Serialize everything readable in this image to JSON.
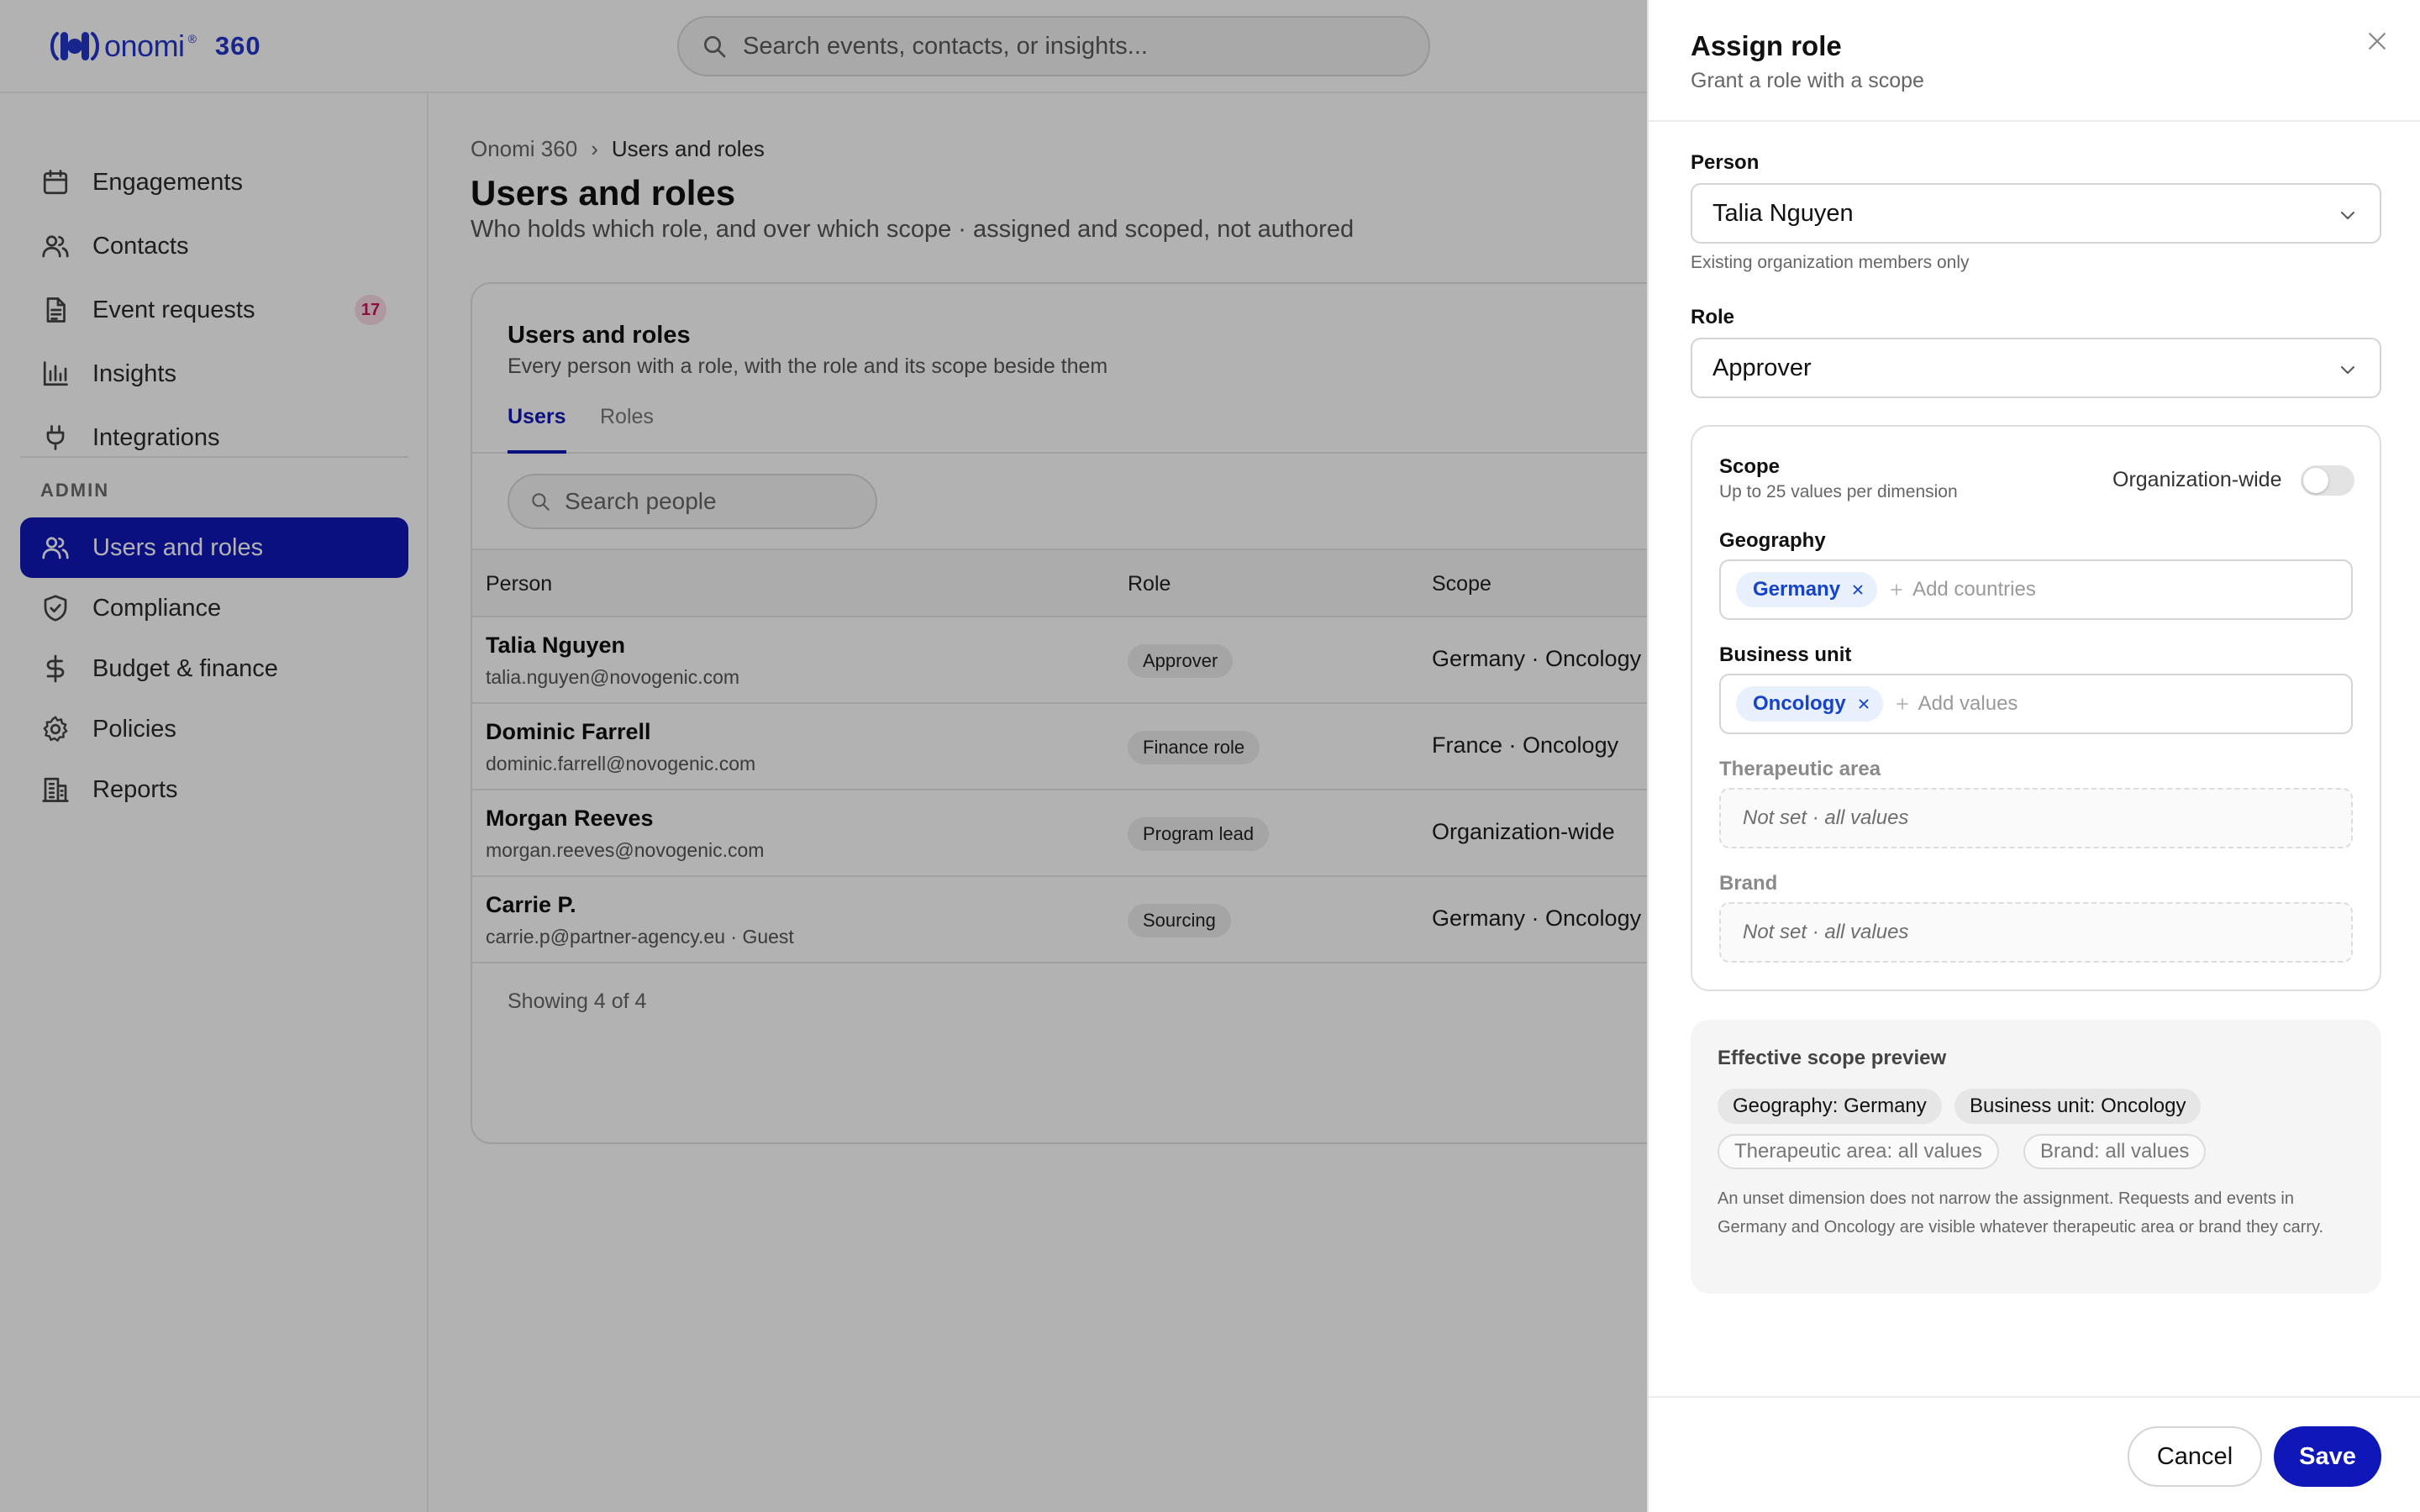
{
  "brand": {
    "logo_text": "onomi",
    "logo_reg": "®",
    "product": "360",
    "accent": "#1017b8"
  },
  "header": {
    "search_placeholder": "Search events, contacts, or insights..."
  },
  "sidebar": {
    "items": [
      {
        "label": "Engagements",
        "icon": "calendar-icon"
      },
      {
        "label": "Contacts",
        "icon": "users-icon"
      },
      {
        "label": "Event requests",
        "icon": "document-icon",
        "badge": "17"
      },
      {
        "label": "Insights",
        "icon": "bar-chart-icon"
      },
      {
        "label": "Integrations",
        "icon": "plug-icon"
      }
    ],
    "admin_section": "ADMIN",
    "admin_items": [
      {
        "label": "Users and roles",
        "icon": "users-icon",
        "active": true
      },
      {
        "label": "Compliance",
        "icon": "shield-icon"
      },
      {
        "label": "Budget & finance",
        "icon": "dollar-icon"
      },
      {
        "label": "Policies",
        "icon": "gear-icon"
      },
      {
        "label": "Reports",
        "icon": "building-icon"
      }
    ]
  },
  "main": {
    "breadcrumb": {
      "root": "Onomi 360",
      "sep": "›",
      "current": "Users and roles"
    },
    "title": "Users and roles",
    "subtitle": "Who holds which role, and over which scope · assigned and scoped, not authored",
    "card": {
      "title": "Users and roles",
      "subtitle": "Every person with a role, with the role and its scope beside them",
      "tabs": [
        "Users",
        "Roles"
      ],
      "search_placeholder": "Search people",
      "columns": [
        "Person",
        "Role",
        "Scope"
      ],
      "rows": [
        {
          "name": "Talia Nguyen",
          "email": "talia.nguyen@novogenic.com",
          "role": "Approver",
          "scope": "Germany · Oncology"
        },
        {
          "name": "Dominic Farrell",
          "email": "dominic.farrell@novogenic.com",
          "role": "Finance role",
          "scope": "France · Oncology"
        },
        {
          "name": "Morgan Reeves",
          "email": "morgan.reeves@novogenic.com",
          "role": "Program lead",
          "scope": "Organization-wide"
        },
        {
          "name": "Carrie P.",
          "email": "carrie.p@partner-agency.eu · Guest",
          "role": "Sourcing",
          "scope": "Germany · Oncology"
        }
      ],
      "footer": "Showing 4 of 4"
    }
  },
  "drawer": {
    "title": "Assign role",
    "subtitle": "Grant a role with a scope",
    "person_label": "Person",
    "person_value": "Talia Nguyen",
    "person_helper": "Existing organization members only",
    "role_label": "Role",
    "role_value": "Approver",
    "scope": {
      "title": "Scope",
      "hint": "Up to 25 values per dimension",
      "org_wide_label": "Organization-wide",
      "org_wide_on": false,
      "geography_label": "Geography",
      "geography_chip": "Germany",
      "geography_add": "Add countries",
      "business_unit_label": "Business unit",
      "business_unit_chip": "Oncology",
      "business_unit_add": "Add values",
      "therapeutic_label": "Therapeutic area",
      "therapeutic_empty": "Not set · all values",
      "brand_label": "Brand",
      "brand_empty": "Not set · all values"
    },
    "preview": {
      "title": "Effective scope preview",
      "set_chips": [
        "Geography: Germany",
        "Business unit: Oncology"
      ],
      "unset_chips": [
        "Therapeutic area: all values",
        "Brand: all values"
      ],
      "note": "An unset dimension does not narrow the assignment. Requests and events in Germany and Oncology are visible whatever therapeutic area or brand they carry."
    },
    "cancel_label": "Cancel",
    "save_label": "Save"
  }
}
